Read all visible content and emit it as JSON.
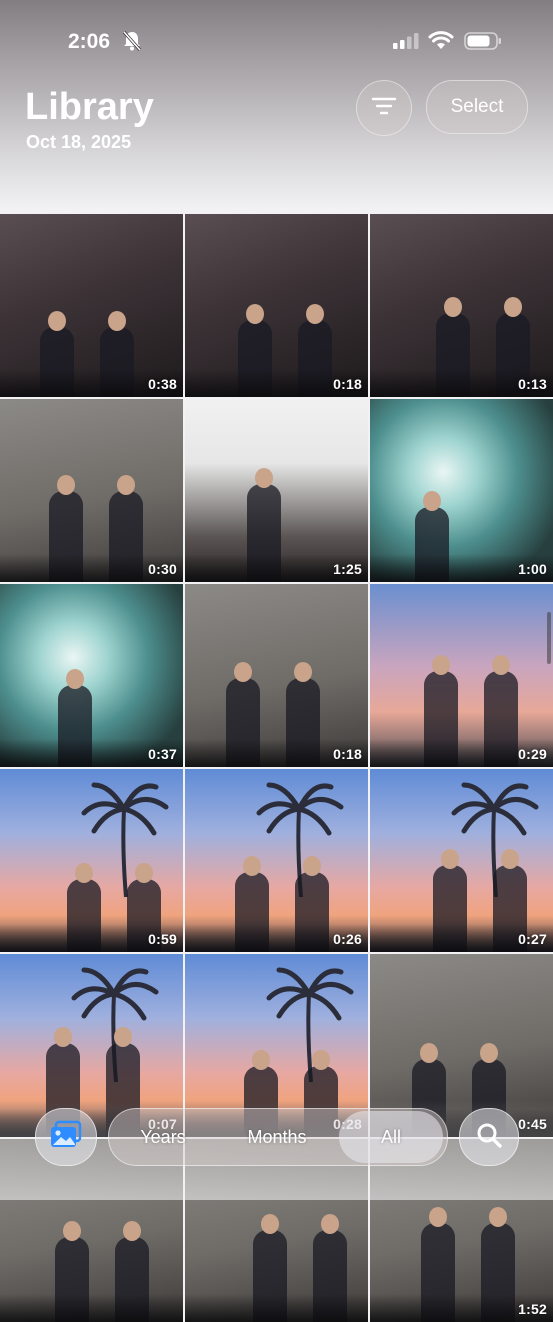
{
  "status_bar": {
    "time": "2:06",
    "battery_level": 0.8
  },
  "header": {
    "title": "Library",
    "date": "Oct 18, 2025",
    "select_label": "Select"
  },
  "grid": {
    "tiles": [
      {
        "duration": "0:38",
        "scene": "stage-dark"
      },
      {
        "duration": "0:18",
        "scene": "stage-dark"
      },
      {
        "duration": "0:13",
        "scene": "stage-dark"
      },
      {
        "duration": "0:30",
        "scene": "stage-grey"
      },
      {
        "duration": "1:25",
        "scene": "stage-white"
      },
      {
        "duration": "1:00",
        "scene": "tunnel"
      },
      {
        "duration": "0:37",
        "scene": "tunnel"
      },
      {
        "duration": "0:18",
        "scene": "stage-grey"
      },
      {
        "duration": "0:29",
        "scene": "sky"
      },
      {
        "duration": "0:59",
        "scene": "sky-palms"
      },
      {
        "duration": "0:26",
        "scene": "sky-palms"
      },
      {
        "duration": "0:27",
        "scene": "sky-palms"
      },
      {
        "duration": "0:07",
        "scene": "sky-palms"
      },
      {
        "duration": "0:28",
        "scene": "sky-palms"
      },
      {
        "duration": "0:45",
        "scene": "stage-grey"
      },
      {
        "duration": "",
        "scene": "stage-grey"
      },
      {
        "duration": "",
        "scene": "stage-grey"
      },
      {
        "duration": "1:52",
        "scene": "stage-grey"
      }
    ]
  },
  "bottom_bar": {
    "segments": [
      {
        "label": "Years",
        "active": false
      },
      {
        "label": "Months",
        "active": false
      },
      {
        "label": "All",
        "active": true
      }
    ]
  },
  "icons": {
    "status": [
      "bell-slash-icon",
      "cellular-signal-icon",
      "wifi-icon",
      "battery-icon"
    ],
    "header": [
      "filter-icon"
    ],
    "bottom": [
      "photo-library-icon",
      "search-icon"
    ]
  },
  "colors": {
    "accent": "#2d8cff",
    "text_on_media": "#ffffff"
  }
}
